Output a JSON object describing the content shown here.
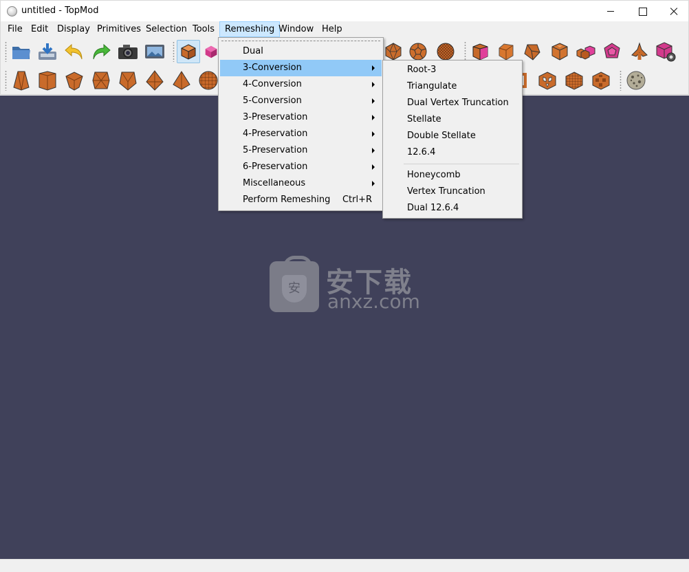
{
  "window": {
    "title": "untitled - TopMod"
  },
  "menubar": {
    "items": [
      "File",
      "Edit",
      "Display",
      "Primitives",
      "Selection",
      "Tools",
      "Remeshing",
      "Window",
      "Help"
    ],
    "active": "Remeshing"
  },
  "remeshing_menu": {
    "items": [
      {
        "label": "Dual"
      },
      {
        "label": "3-Conversion",
        "submenu": true,
        "highlighted": true
      },
      {
        "label": "4-Conversion",
        "submenu": true
      },
      {
        "label": "5-Conversion",
        "submenu": true
      },
      {
        "label": "3-Preservation",
        "submenu": true
      },
      {
        "label": "4-Preservation",
        "submenu": true
      },
      {
        "label": "5-Preservation",
        "submenu": true
      },
      {
        "label": "6-Preservation",
        "submenu": true
      },
      {
        "label": "Miscellaneous",
        "submenu": true
      },
      {
        "label": "Perform Remeshing",
        "shortcut": "Ctrl+R"
      }
    ]
  },
  "conversion3_submenu": {
    "group1": [
      "Root-3",
      "Triangulate",
      "Dual Vertex Truncation",
      "Stellate",
      "Double Stellate",
      "12.6.4"
    ],
    "group2": [
      "Honeycomb",
      "Vertex Truncation",
      "Dual 12.6.4"
    ]
  },
  "toolbar": {
    "file_icons": [
      "open-folder-icon",
      "save-icon",
      "undo-icon",
      "redo-icon",
      "camera-icon",
      "screenshot-icon"
    ],
    "mode_icons": [
      "object-mode-cube-icon",
      "face-mode-cube-icon"
    ],
    "primitive_icons": [
      "icosahedron-icon",
      "soccer-ball-icon",
      "geodesic-sphere-icon"
    ],
    "tool_icons": [
      "extrude-face-icon",
      "cut-corner-icon",
      "bevel-icon",
      "chamfer-cube-icon",
      "small-cubes-icon",
      "dodecahedron-pink-icon",
      "branch-icon",
      "settings-cube-icon"
    ],
    "row2_left_icons": [
      "frustum-icon",
      "dome-cube-icon",
      "wedge-icon",
      "stellated-cube-icon",
      "octa-icon",
      "pyramid-icon",
      "tetra-icon",
      "mesh-sphere-icon"
    ],
    "row2_right_icons": [
      "lattice-box-icon",
      "holed-cube-icon",
      "grid-cube-icon",
      "sponge-cube-icon",
      "textured-sphere-icon"
    ]
  },
  "watermark": {
    "glyph": "安",
    "brand": "安下载",
    "domain": "anxz.com"
  },
  "colors": {
    "viewport": "#40415a",
    "highlight": "#91c9f7",
    "orange": "#d8722e",
    "pink": "#e0409a"
  }
}
